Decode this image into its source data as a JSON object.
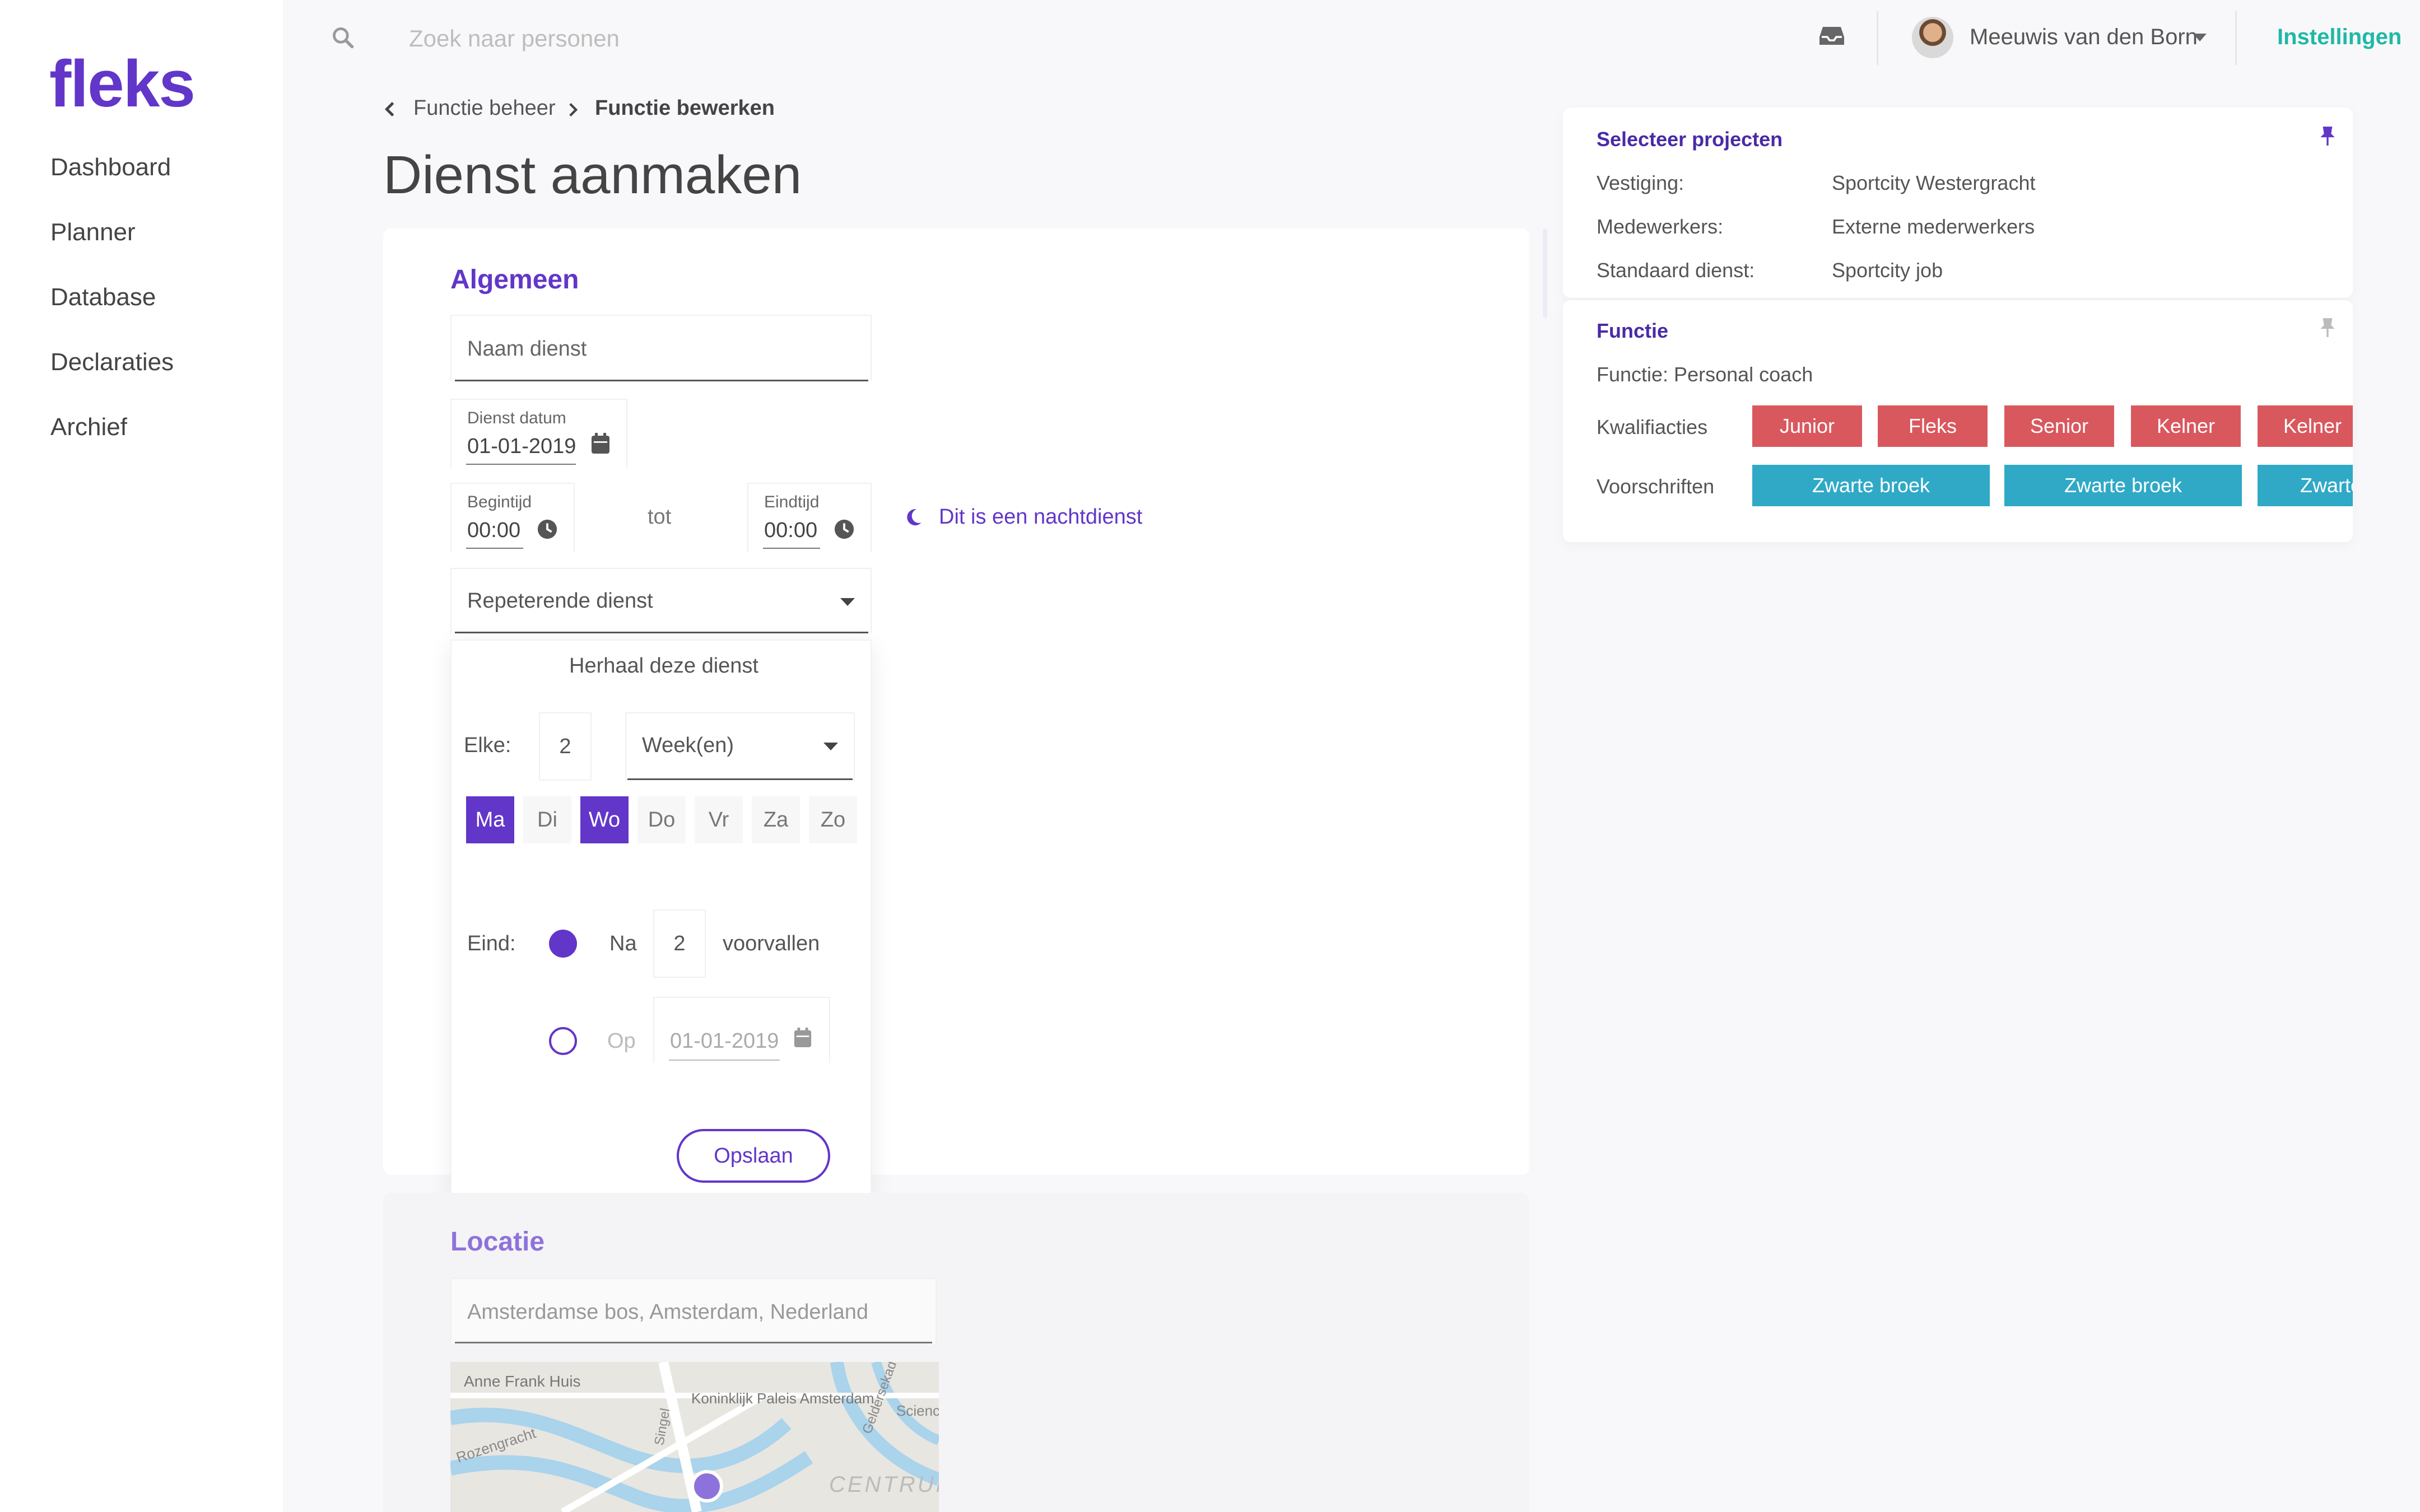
{
  "brand": {
    "logo_text": "fleks",
    "color": "#6236c9"
  },
  "sidebar": {
    "items": [
      {
        "label": "Dashboard"
      },
      {
        "label": "Planner"
      },
      {
        "label": "Database"
      },
      {
        "label": "Declaraties"
      },
      {
        "label": "Archief"
      }
    ]
  },
  "topbar": {
    "search_placeholder": "Zoek naar personen",
    "user_name": "Meeuwis van den Born",
    "settings_label": "Instellingen"
  },
  "breadcrumb": {
    "parent": "Functie beheer",
    "current": "Functie bewerken"
  },
  "page_title": "Dienst aanmaken",
  "general": {
    "title": "Algemeen",
    "name_placeholder": "Naam dienst",
    "date_label": "Dienst datum",
    "date_value": "01-01-2019",
    "start_label": "Begintijd",
    "start_value": "00:00",
    "to_label": "tot",
    "end_label": "Eindtijd",
    "end_value": "00:00",
    "night_label": "Dit is een nachtdienst",
    "repeat_label": "Repeterende dienst"
  },
  "repeat_popup": {
    "title": "Herhaal deze dienst",
    "every_label": "Elke:",
    "every_value": "2",
    "period_value": "Week(en)",
    "days": [
      {
        "label": "Ma",
        "selected": true
      },
      {
        "label": "Di",
        "selected": false
      },
      {
        "label": "Wo",
        "selected": true
      },
      {
        "label": "Do",
        "selected": false
      },
      {
        "label": "Vr",
        "selected": false
      },
      {
        "label": "Za",
        "selected": false
      },
      {
        "label": "Zo",
        "selected": false
      }
    ],
    "end_label": "Eind:",
    "after_label": "Na",
    "after_value": "2",
    "occurrences_label": "voorvallen",
    "on_label": "Op",
    "on_date_value": "01-01-2019",
    "save_label": "Opslaan"
  },
  "location": {
    "title": "Locatie",
    "address_value": "Amsterdamse bos, Amsterdam, Nederland",
    "map_labels": [
      "Anne Frank Huis",
      "Koninklijk Paleis Amsterdam",
      "Rozengracht",
      "Singel",
      "Geldersekade",
      "Scienc",
      "CENTRUM"
    ]
  },
  "projects_panel": {
    "title": "Selecteer projecten",
    "rows": [
      {
        "label": "Vestiging:",
        "value": "Sportcity Westergracht"
      },
      {
        "label": "Medewerkers:",
        "value": "Externe mederwerkers"
      },
      {
        "label": "Standaard dienst:",
        "value": "Sportcity job"
      }
    ]
  },
  "function_panel": {
    "title": "Functie",
    "function_line": "Functie: Personal coach",
    "qualifications_label": "Kwalifiacties",
    "qualifications": [
      "Junior",
      "Fleks",
      "Senior",
      "Kelner",
      "Kelner"
    ],
    "rules_label": "Voorschriften",
    "rules": [
      "Zwarte broek",
      "Zwarte broek",
      "Zwarte"
    ]
  },
  "colors": {
    "accent": "#6236c9",
    "teal": "#1fb8a6",
    "tag_red": "#d9585e",
    "tag_blue": "#2fa9c6"
  }
}
